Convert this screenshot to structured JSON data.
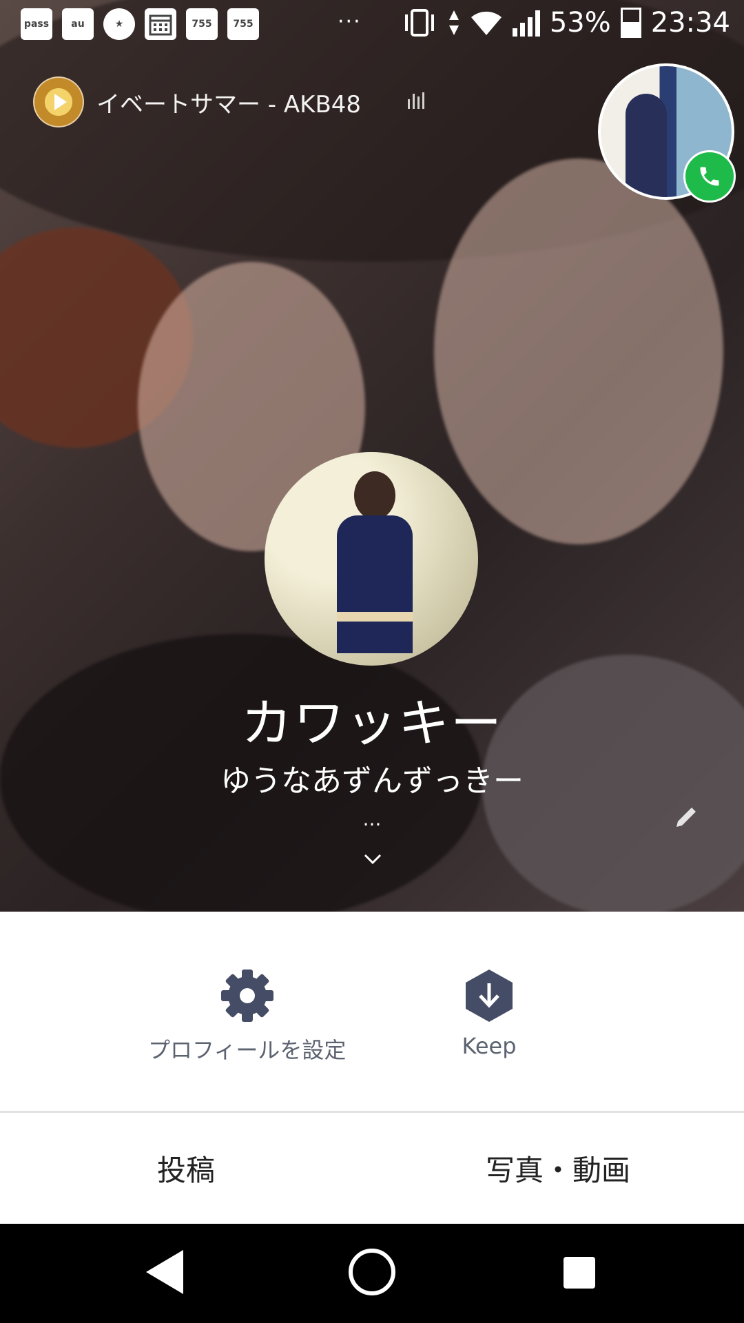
{
  "status_bar": {
    "left_icons": [
      "pass",
      "au",
      "★",
      "calendar",
      "755",
      "755"
    ],
    "overflow": "···",
    "battery": "53%",
    "time": "23:34"
  },
  "music": {
    "title": "イベートサマー - AKB48"
  },
  "profile": {
    "name": "カワッキー",
    "status_message": "ゆうなあずんずっきー",
    "more": "..."
  },
  "actions": {
    "settings_label": "プロフィールを設定",
    "keep_label": "Keep"
  },
  "tabs": [
    "投稿",
    "写真・動画"
  ],
  "colors": {
    "call_green": "#1fbb4a",
    "icon_navy": "#454d66"
  }
}
